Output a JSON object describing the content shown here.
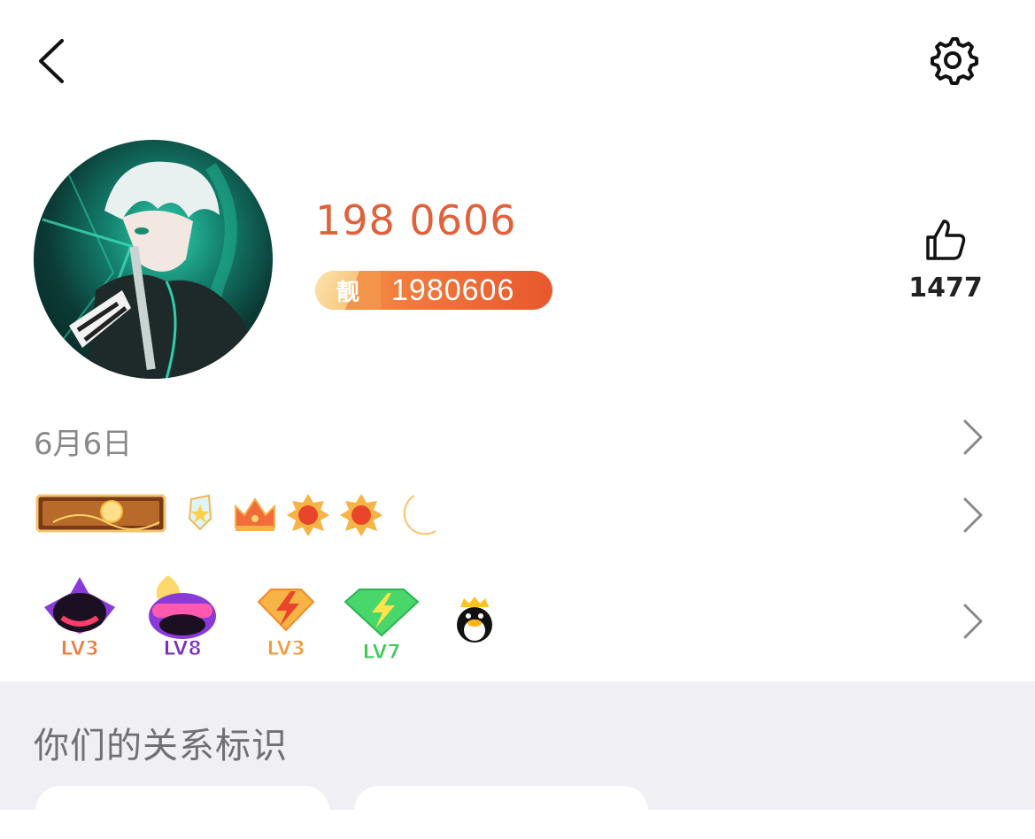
{
  "header": {
    "back_icon": "chevron-left-icon",
    "settings_icon": "gear-icon"
  },
  "profile": {
    "avatar_icon": "anime-character-avatar",
    "display_name": "198 0606",
    "id_badge": {
      "tag": "靓",
      "number": "1980606"
    },
    "likes": {
      "icon": "thumbs-up-icon",
      "count": "1477"
    }
  },
  "info_rows": {
    "birthday": "6月6日"
  },
  "badges": {
    "row1": [
      {
        "name": "golden-banner-badge"
      },
      {
        "name": "star-shield-badge"
      },
      {
        "name": "crown-badge"
      },
      {
        "name": "sun-badge"
      },
      {
        "name": "sun-badge"
      },
      {
        "name": "moon-badge"
      }
    ],
    "row2": [
      {
        "name": "dark-gem-level-badge",
        "level": "LV3"
      },
      {
        "name": "flame-hair-level-badge",
        "level": "LV8"
      },
      {
        "name": "lightning-diamond-badge",
        "level": "LV3"
      },
      {
        "name": "green-diamond-badge",
        "level": "LV7"
      },
      {
        "name": "penguin-crown-badge"
      }
    ]
  },
  "relation": {
    "title": "你们的关系标识"
  },
  "colors": {
    "accent": "#e0613a",
    "section_bg": "#efeff4"
  }
}
